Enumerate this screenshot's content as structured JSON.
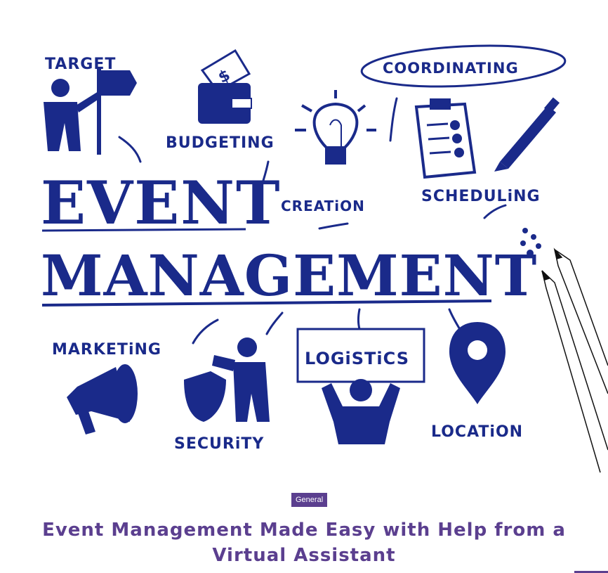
{
  "hero": {
    "labels": {
      "target": "TARGET",
      "budgeting": "BUDGETING",
      "coordinating": "COORDINATING",
      "creation": "CREATiON",
      "scheduling": "SCHEDULiNG",
      "event": "EVENT",
      "management": "MANAGEMENT",
      "marketing": "MARKETiNG",
      "logistics": "LOGiSTiCS",
      "security": "SECURiTY",
      "location": "LOCATiON"
    },
    "ink_color": "#1a2a8a"
  },
  "post": {
    "category": "General",
    "title": "Event Management Made Easy with Help from a Virtual Assistant"
  },
  "colors": {
    "accent": "#5b3f8f",
    "ink": "#1a2a8a",
    "background": "#ffffff"
  }
}
